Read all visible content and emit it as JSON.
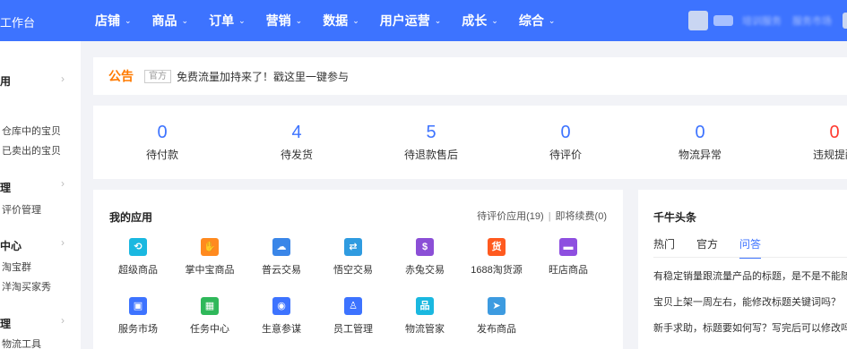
{
  "topbar": {
    "brand": "工作台",
    "nav": [
      "店铺",
      "商品",
      "订单",
      "营销",
      "数据",
      "用户运营",
      "成长",
      "综合"
    ],
    "right_links": [
      "培训服务",
      "服务市场"
    ]
  },
  "sidebar": {
    "sections": [
      {
        "head": "用",
        "items": []
      },
      {
        "head": "",
        "items": [
          "仓库中的宝贝",
          "已卖出的宝贝"
        ]
      },
      {
        "head": "理",
        "items": [
          "评价管理"
        ]
      },
      {
        "head": "中心",
        "items": [
          "淘宝群",
          "洋淘买家秀"
        ]
      },
      {
        "head": "理",
        "items": [
          "物流工具"
        ]
      }
    ]
  },
  "notice": {
    "title": "公告",
    "badge": "官方",
    "text": "免费流量加持来了！戳这里一键参与"
  },
  "stats": [
    {
      "value": "0",
      "label": "待付款"
    },
    {
      "value": "4",
      "label": "待发货"
    },
    {
      "value": "5",
      "label": "待退款售后"
    },
    {
      "value": "0",
      "label": "待评价"
    },
    {
      "value": "0",
      "label": "物流异常"
    },
    {
      "value": "0",
      "label": "违规提醒"
    }
  ],
  "apps": {
    "title": "我的应用",
    "right_a": "待评价应用(19)",
    "right_b": "即将续费(0)",
    "items": [
      {
        "label": "超级商品",
        "icon": "refresh-icon",
        "color": "#1ab8e0",
        "glyph": "⟲"
      },
      {
        "label": "掌中宝商品",
        "icon": "hand-icon",
        "color": "#ff8a1f",
        "glyph": "✋"
      },
      {
        "label": "普云交易",
        "icon": "cloud-icon",
        "color": "#3a86e8",
        "glyph": "☁"
      },
      {
        "label": "悟空交易",
        "icon": "trade-icon",
        "color": "#2f9be0",
        "glyph": "⇄"
      },
      {
        "label": "赤兔交易",
        "icon": "moneybag-icon",
        "color": "#8b4fd6",
        "glyph": "$"
      },
      {
        "label": "1688淘货源",
        "icon": "source-icon",
        "color": "#ff5a1f",
        "glyph": "货"
      },
      {
        "label": "旺店商品",
        "icon": "store-icon",
        "color": "#8e4fe0",
        "glyph": "▬"
      },
      {
        "label": "服务市场",
        "icon": "bag-icon",
        "color": "#3d73ff",
        "glyph": "▣"
      },
      {
        "label": "任务中心",
        "icon": "calendar-icon",
        "color": "#2fb85a",
        "glyph": "▦"
      },
      {
        "label": "生意参谋",
        "icon": "compass-icon",
        "color": "#3d73ff",
        "glyph": "◉"
      },
      {
        "label": "员工管理",
        "icon": "user-icon",
        "color": "#3d73ff",
        "glyph": "♙"
      },
      {
        "label": "物流管家",
        "icon": "logistics-icon",
        "color": "#1ab8e0",
        "glyph": "品"
      },
      {
        "label": "发布商品",
        "icon": "send-icon",
        "color": "#3d9be0",
        "glyph": "➤"
      }
    ]
  },
  "news": {
    "title": "千牛头条",
    "tabs": [
      "热门",
      "官方",
      "问答"
    ],
    "active_tab": "问答",
    "questions": [
      "有稳定销量跟流量产品的标题，是不是不能随",
      "宝贝上架一周左右，能修改标题关键词吗？",
      "新手求助，标题要如何写？写完后可以修改吗"
    ]
  }
}
